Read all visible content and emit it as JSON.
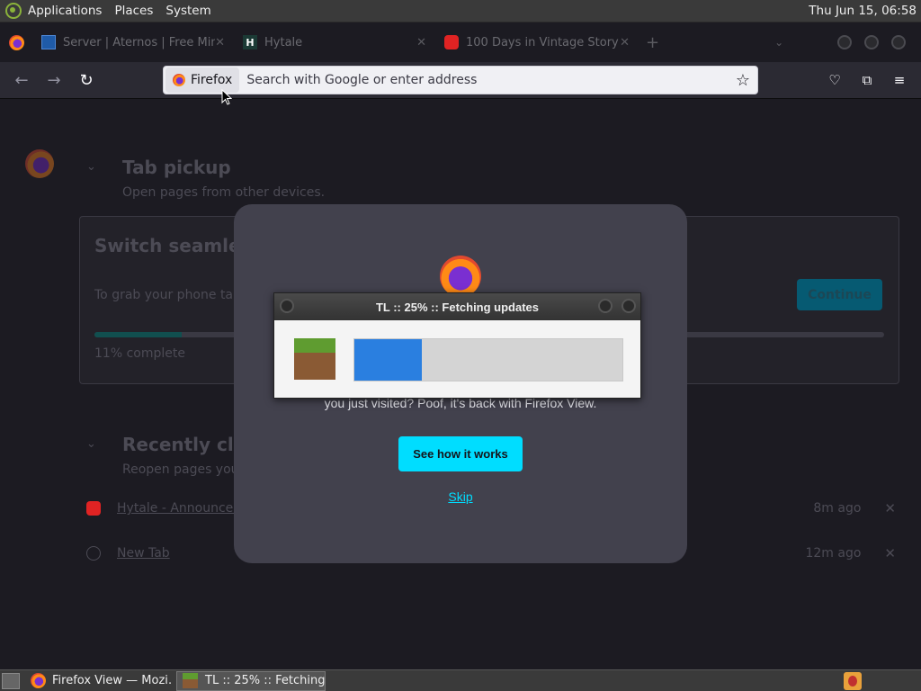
{
  "system_panel": {
    "menus": [
      "Applications",
      "Places",
      "System"
    ],
    "clock": "Thu Jun 15, 06:58"
  },
  "tabs": [
    {
      "title": "Server | Aternos | Free Min",
      "favicon": "aternos-icon"
    },
    {
      "title": "Hytale",
      "favicon": "hytale-icon"
    },
    {
      "title": "100 Days in Vintage Story",
      "favicon": "youtube-icon"
    }
  ],
  "navbar": {
    "identity_label": "Firefox",
    "url_placeholder": "Search with Google or enter address"
  },
  "page": {
    "tab_pickup": {
      "heading": "Tab pickup",
      "subheading": "Open pages from other devices.",
      "card_title": "Switch seamles",
      "card_text": "To grab your phone tab",
      "continue_label": "Continue",
      "progress_percent": 11,
      "progress_label": "11% complete"
    },
    "recently_closed": {
      "heading": "Recently clo",
      "subheading": "Reopen pages you'",
      "items": [
        {
          "title": "Hytale - Announcen",
          "time": "8m ago",
          "icon": "youtube-icon"
        },
        {
          "title": "New Tab",
          "time": "12m ago",
          "icon": "globe-icon"
        }
      ]
    }
  },
  "modal": {
    "description": "you just visited? Poof, it's back with Firefox View.",
    "primary_button": "See how it works",
    "skip_link": "Skip"
  },
  "progress_dialog": {
    "title": "TL :: 25% :: Fetching updates",
    "progress_percent": 25,
    "icon": "minecraft-grass-block-icon"
  },
  "taskbar": {
    "tasks": [
      {
        "label": "Firefox View — Mozi…",
        "active": false
      },
      {
        "label": "TL :: 25% :: Fetching …",
        "active": true
      }
    ]
  },
  "colors": {
    "accent_cyan": "#00ddff",
    "progress_blue": "#2a7fe0",
    "modal_bg": "#42414d",
    "page_bg": "#1c1b22"
  }
}
